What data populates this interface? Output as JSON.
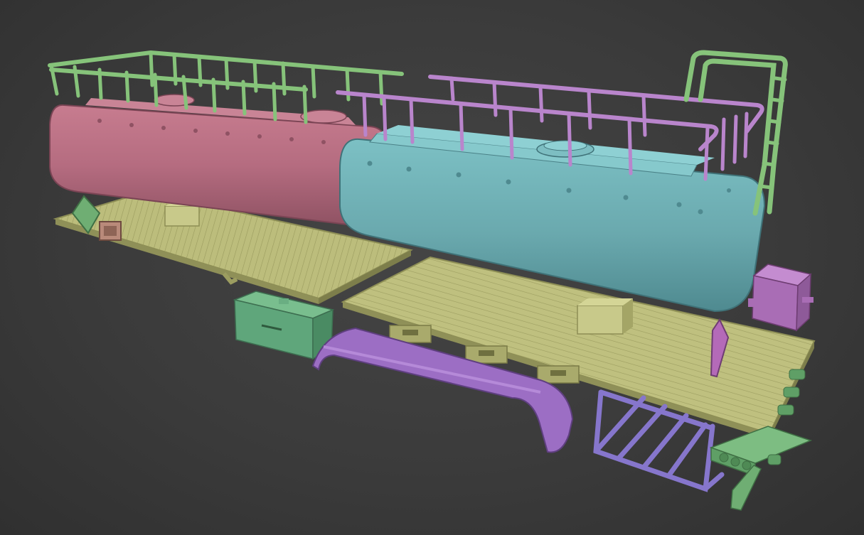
{
  "scene": {
    "kind": "3d-model-viewport",
    "background_color": "#3c3c3c",
    "parts": [
      {
        "name": "green-railing-left",
        "color": "#86c37a"
      },
      {
        "name": "pink-tank",
        "color": "#b96f82"
      },
      {
        "name": "teal-tank",
        "color": "#6fb0b5"
      },
      {
        "name": "purple-railing",
        "color": "#b985cc"
      },
      {
        "name": "green-ladder",
        "color": "#86c37a"
      },
      {
        "name": "olive-flatbed-left",
        "color": "#b9bb79"
      },
      {
        "name": "olive-flatbed-right",
        "color": "#b9bb79"
      },
      {
        "name": "green-toolbox",
        "color": "#5fa67b"
      },
      {
        "name": "purple-fender",
        "color": "#9c6ec4"
      },
      {
        "name": "violet-rack",
        "color": "#8676cc"
      },
      {
        "name": "magenta-box",
        "color": "#a96db5"
      },
      {
        "name": "green-bumper",
        "color": "#6fae73"
      }
    ]
  }
}
